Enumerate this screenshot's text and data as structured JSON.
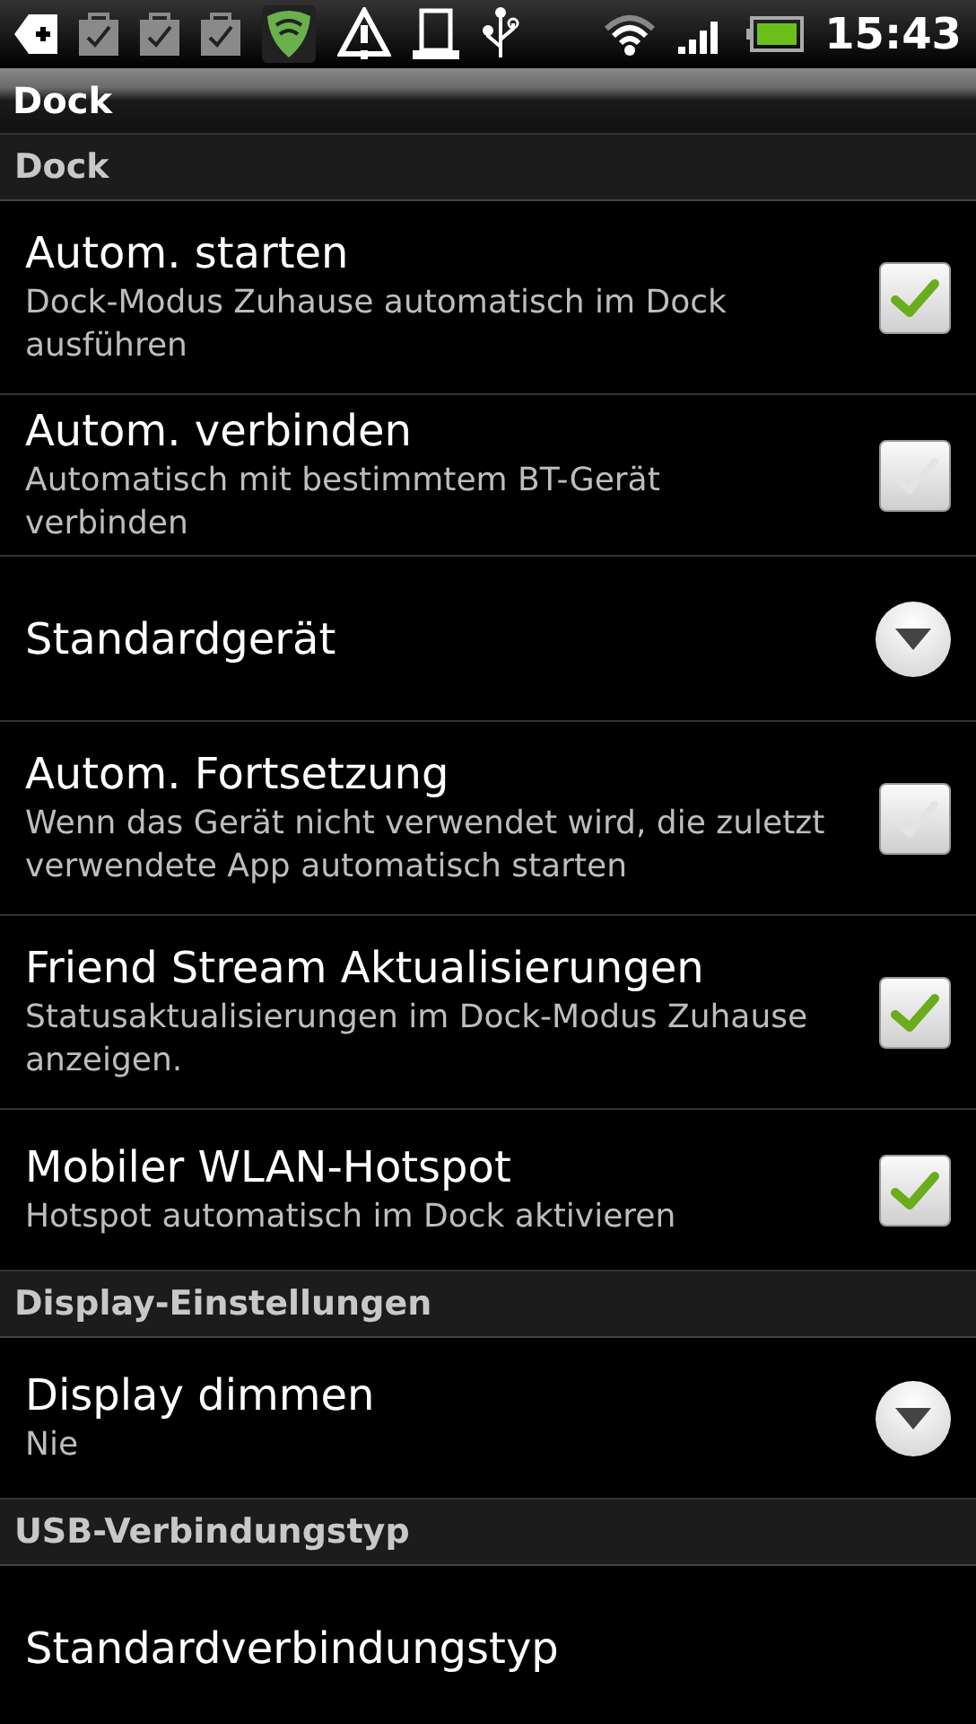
{
  "status_bar": {
    "time": "15:43"
  },
  "title": "Dock",
  "sections": [
    {
      "header": "Dock",
      "items": [
        {
          "kind": "checkbox",
          "title": "Autom. starten",
          "summary": "Dock-Modus Zuhause automatisch im Dock ausführen",
          "checked": true
        },
        {
          "kind": "checkbox",
          "title": "Autom. verbinden",
          "summary": "Automatisch mit bestimmtem BT-Gerät verbinden",
          "checked": false
        },
        {
          "kind": "dropdown",
          "title": "Standardgerät"
        },
        {
          "kind": "checkbox",
          "title": "Autom. Fortsetzung",
          "summary": "Wenn das Gerät nicht verwendet wird, die zuletzt verwendete App automatisch starten",
          "checked": false
        },
        {
          "kind": "checkbox",
          "title": "Friend Stream Aktualisierungen",
          "summary": "Statusaktualisierungen im Dock-Modus Zuhause anzeigen.",
          "checked": true
        },
        {
          "kind": "checkbox",
          "title": "Mobiler WLAN-Hotspot",
          "summary": "Hotspot automatisch im Dock aktivieren",
          "checked": true
        }
      ]
    },
    {
      "header": "Display-Einstellungen",
      "items": [
        {
          "kind": "dropdown",
          "title": "Display dimmen",
          "summary": "Nie"
        }
      ]
    },
    {
      "header": "USB-Verbindungstyp",
      "items": [
        {
          "kind": "plain",
          "title": "Standardverbindungstyp"
        }
      ]
    }
  ]
}
